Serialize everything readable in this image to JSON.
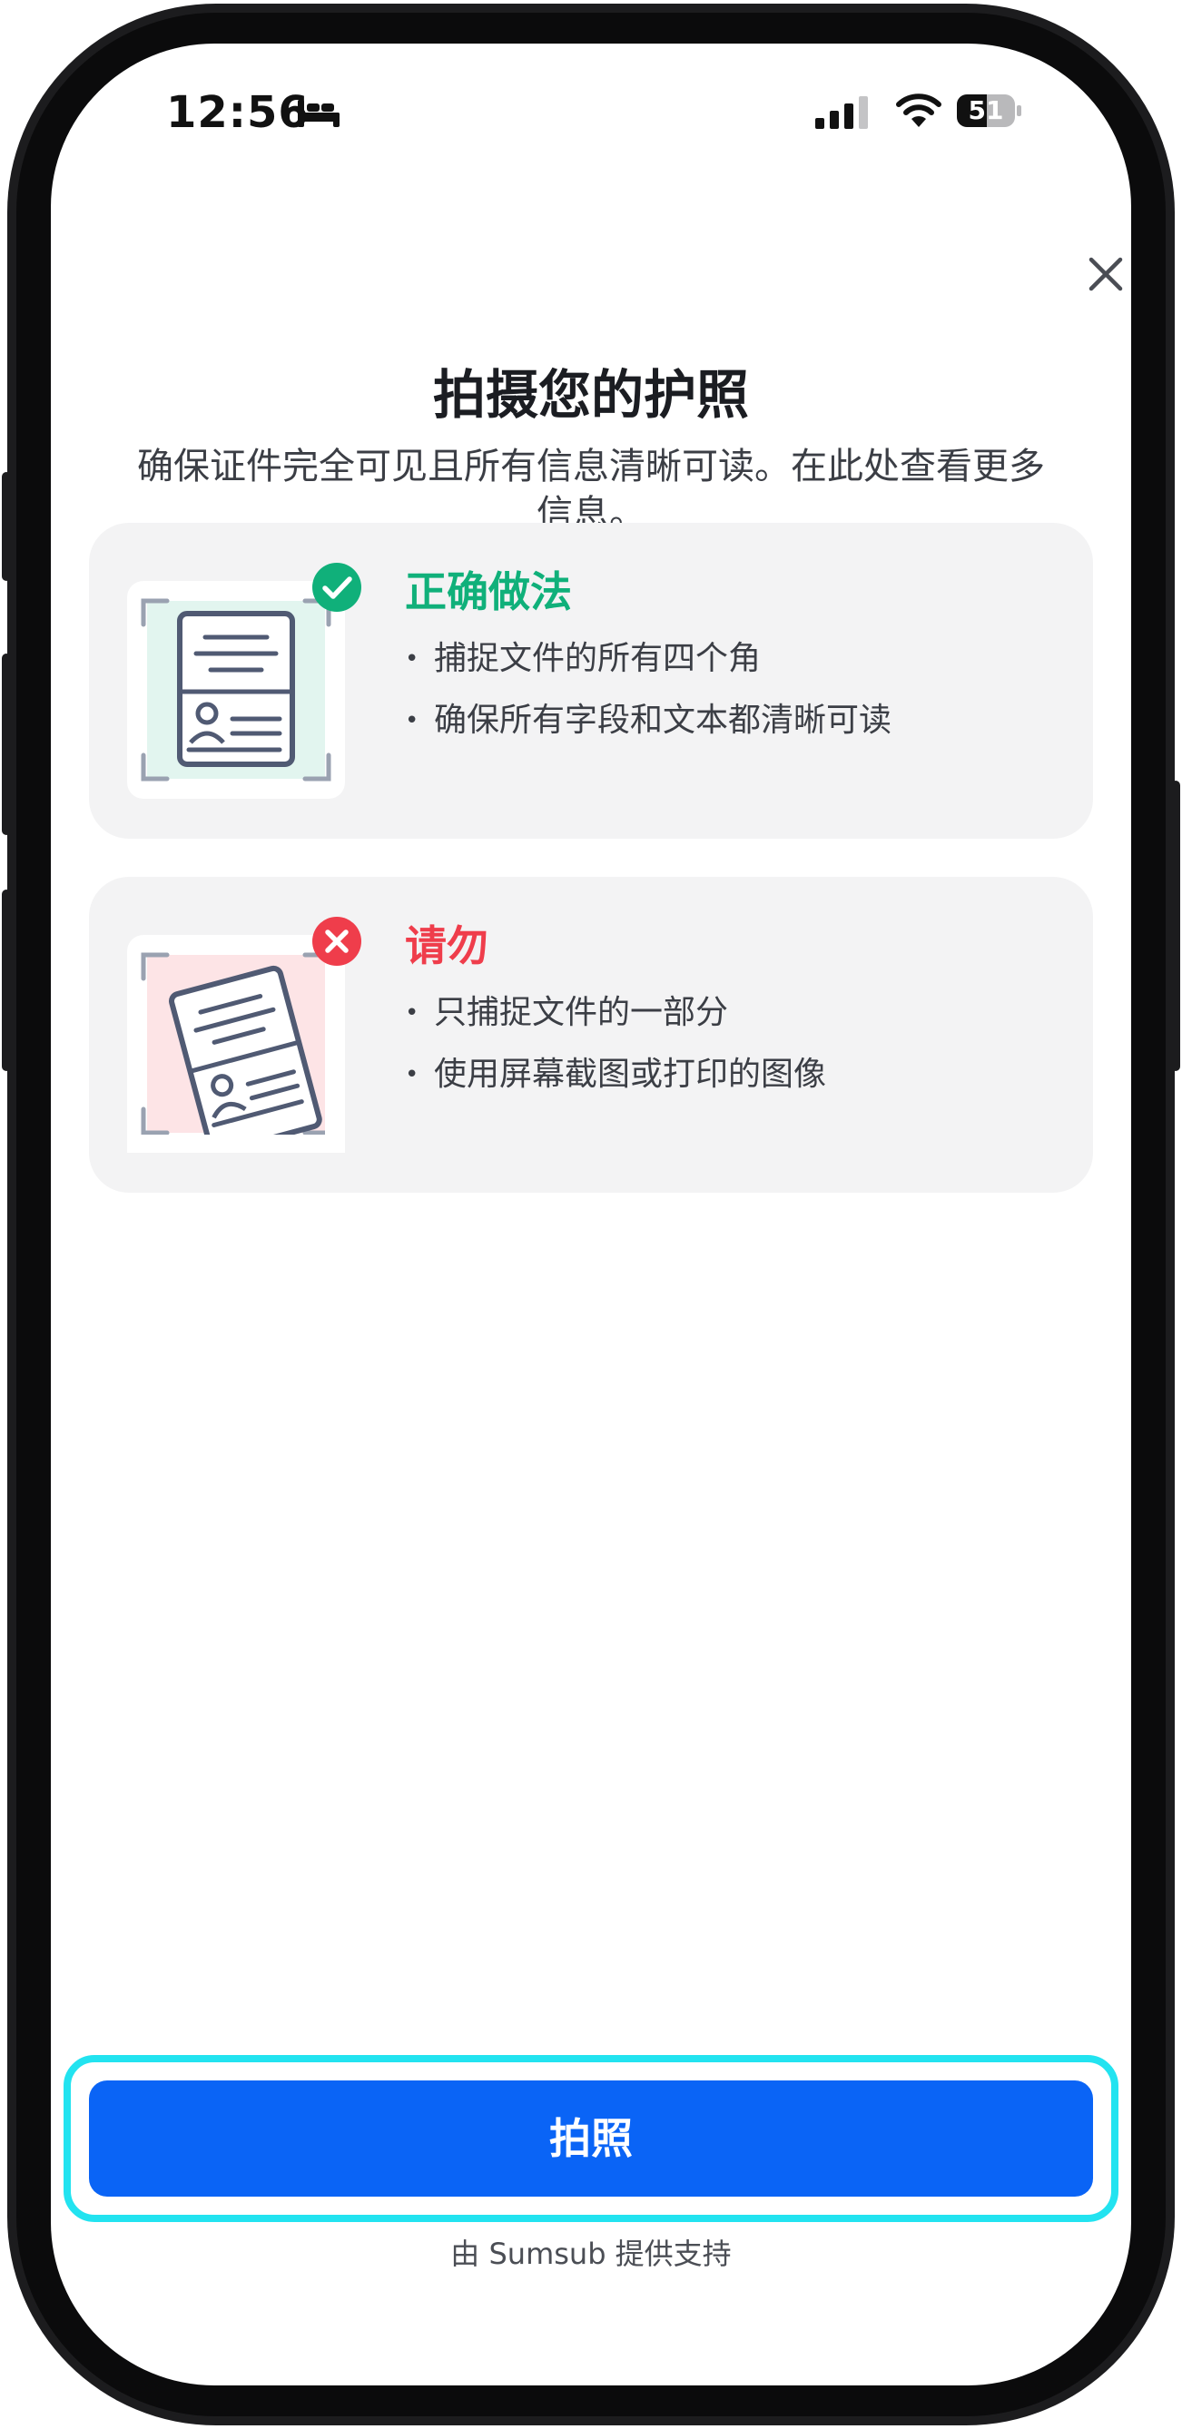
{
  "status_bar": {
    "time": "12:56",
    "battery_percent": "51",
    "battery_level": 0.51,
    "icons": [
      "bed-icon",
      "cellular-signal-icon",
      "wifi-icon",
      "battery-icon"
    ]
  },
  "header": {
    "close_icon": "close-icon",
    "title": "拍摄您的护照",
    "subtitle": "确保证件完全可见且所有信息清晰可读。在此处查看更多信息。"
  },
  "cards": [
    {
      "heading": "正确做法",
      "status": "correct",
      "badge_icon": "check-circle-icon",
      "accent_color": "#10b07a",
      "illustration_bg": "#e2f5ef",
      "bullets": [
        "捕捉文件的所有四个角",
        "确保所有字段和文本都清晰可读"
      ]
    },
    {
      "heading": "请勿",
      "status": "incorrect",
      "badge_icon": "x-circle-icon",
      "accent_color": "#ef3d4b",
      "illustration_bg": "#fde4e6",
      "bullets": [
        "只捕捉文件的一部分",
        "使用屏幕截图或打印的图像"
      ]
    }
  ],
  "primary_button": {
    "label": "拍照",
    "color": "#0a64f6"
  },
  "footer": {
    "text": "由 Sumsub 提供支持"
  }
}
